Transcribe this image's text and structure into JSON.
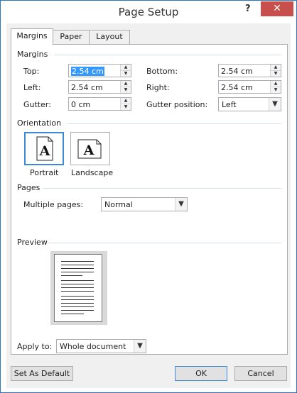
{
  "window": {
    "title": "Page Setup",
    "help_label": "?",
    "close_label": "✕"
  },
  "tabs": [
    {
      "label": "Margins"
    },
    {
      "label": "Paper"
    },
    {
      "label": "Layout"
    }
  ],
  "margins": {
    "group_label": "Margins",
    "top": {
      "label": "Top:",
      "value": "2.54 cm"
    },
    "bottom": {
      "label": "Bottom:",
      "value": "2.54 cm"
    },
    "left": {
      "label": "Left:",
      "value": "2.54 cm"
    },
    "right": {
      "label": "Right:",
      "value": "2.54 cm"
    },
    "gutter": {
      "label": "Gutter:",
      "value": "0 cm"
    },
    "gutter_position": {
      "label": "Gutter position:",
      "value": "Left"
    }
  },
  "orientation": {
    "group_label": "Orientation",
    "portrait": {
      "label": "Portrait",
      "glyph": "A"
    },
    "landscape": {
      "label": "Landscape",
      "glyph": "A"
    }
  },
  "pages": {
    "group_label": "Pages",
    "multiple_pages_label": "Multiple pages:",
    "multiple_pages_value": "Normal"
  },
  "preview": {
    "group_label": "Preview"
  },
  "apply_to": {
    "label": "Apply to:",
    "value": "Whole document"
  },
  "buttons": {
    "set_default": "Set As Default",
    "ok": "OK",
    "cancel": "Cancel"
  },
  "icons": {
    "spin_up": "▲",
    "spin_down": "▼",
    "dropdown": "▼"
  }
}
